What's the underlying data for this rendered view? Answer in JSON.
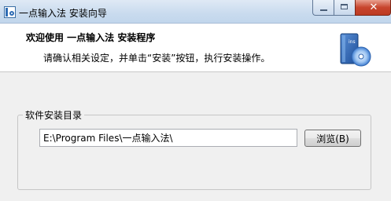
{
  "window": {
    "title": "一点输入法 安装向导",
    "close_symbol": "✕"
  },
  "header": {
    "title": "欢迎使用  一点输入法  安装程序",
    "subtitle": "请确认相关设定，并单击“安装”按钮，执行安装操作。",
    "icon": "install-disc-icon",
    "icon_label": "ins"
  },
  "install_dir": {
    "group_label": "软件安装目录",
    "path_value": "E:\\Program Files\\一点输入法\\",
    "browse_label": "浏览(B)"
  },
  "colors": {
    "titlebar": "#c9dbee",
    "close_button": "#c7452d",
    "header_bg": "#ffffff",
    "body_bg": "#f0f0f0"
  }
}
